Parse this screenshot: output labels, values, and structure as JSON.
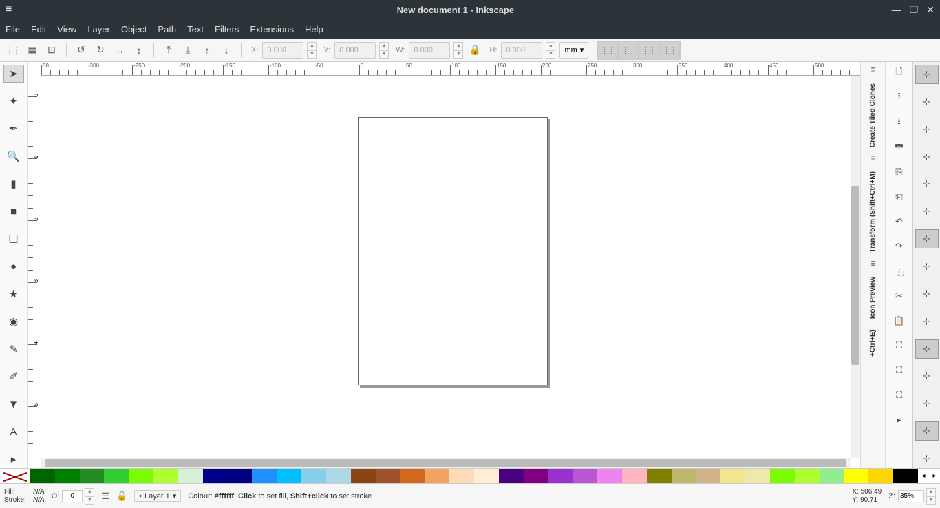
{
  "titlebar": {
    "title": "New document 1 - Inkscape"
  },
  "menus": [
    "File",
    "Edit",
    "View",
    "Layer",
    "Object",
    "Path",
    "Text",
    "Filters",
    "Extensions",
    "Help"
  ],
  "toolbar": {
    "x_label": "X:",
    "x_value": "0.000",
    "y_label": "Y:",
    "y_value": "0.000",
    "w_label": "W:",
    "w_value": "0.000",
    "h_label": "H:",
    "h_value": "0.000",
    "unit": "mm"
  },
  "ruler_h_labels": [
    "50",
    "-300",
    "-250",
    "-200",
    "-150",
    "-100",
    "-50",
    "0",
    "50",
    "100",
    "150",
    "200",
    "250",
    "300",
    "350",
    "400",
    "450",
    "500"
  ],
  "ruler_v_labels": [
    "0",
    "1",
    "2",
    "3",
    "4",
    "5"
  ],
  "dock_labels": {
    "tiled": "Create Tiled Clones",
    "transform": "Transform (Shift+Ctrl+M)",
    "preview": "Icon Preview",
    "export": "+Ctrl+E)"
  },
  "palette": [
    "#006400",
    "#008000",
    "#228B22",
    "#32CD32",
    "#7CFC00",
    "#ADFF2F",
    "#D8F0D8",
    "#00008B",
    "#000080",
    "#1E90FF",
    "#00BFFF",
    "#87CEEB",
    "#ADD8E6",
    "#8B4513",
    "#A0522D",
    "#D2691E",
    "#F4A460",
    "#FFDAB9",
    "#FFEFD5",
    "#4B0082",
    "#800080",
    "#9932CC",
    "#BA55D3",
    "#EE82EE",
    "#FFB6C1",
    "#808000",
    "#BDB76B",
    "#D2B48C",
    "#F0E68C",
    "#EEE8AA",
    "#7CFC00",
    "#ADFF2F",
    "#90EE90",
    "#FFFF00",
    "#FFD700",
    "#000000"
  ],
  "status": {
    "fill_label": "Fill:",
    "fill_value": "N/A",
    "stroke_label": "Stroke:",
    "stroke_value": "N/A",
    "opacity_label": "O:",
    "opacity_value": "0",
    "layer": "Layer 1",
    "msg_prefix": "Colour: ",
    "msg_color": "#ffffff",
    "msg_sep": "; ",
    "msg_click_b": "Click",
    "msg_click_rest": " to set fill, ",
    "msg_shift_b": "Shift+click",
    "msg_shift_rest": " to set stroke",
    "x_label": "X:",
    "x_value": "506.49",
    "y_label": "Y:",
    "y_value": "90.71",
    "z_label": "Z:",
    "z_value": "35%"
  }
}
